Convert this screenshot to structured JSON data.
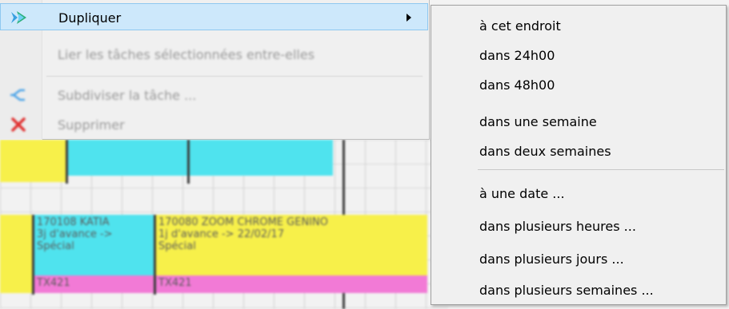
{
  "context_menu": {
    "items": [
      {
        "label": "Dupliquer",
        "icon": "duplicate-icon",
        "state": "highlighted",
        "has_submenu": true
      },
      {
        "label": "Lier les tâches sélectionnées entre-elles",
        "icon": "",
        "state": "disabled"
      },
      {
        "label": "Subdiviser la tâche ...",
        "icon": "split-icon",
        "state": "disabled"
      },
      {
        "label": "Supprimer",
        "icon": "delete-icon",
        "state": "disabled"
      }
    ]
  },
  "submenu": {
    "groups": [
      [
        "à cet endroit",
        "dans 24h00",
        "dans 48h00",
        "dans une semaine",
        "dans deux semaines"
      ],
      [
        "à une date ...",
        "dans plusieurs heures ...",
        "dans plusieurs jours ...",
        "dans plusieurs semaines ..."
      ]
    ]
  },
  "background_schedule": {
    "blocks": [
      {
        "text": "170108 KATIA",
        "line2": "3j d'avance ->",
        "line3": "Spécial",
        "code": "TX421"
      },
      {
        "text": "170080 ZOOM CHROME GENINO",
        "line2": "1j d'avance -> 22/02/17",
        "line3": "Spécial",
        "code": "TX421"
      }
    ]
  },
  "colors": {
    "menu_bg": "#f0f0f0",
    "highlight_bg": "#cde8fb",
    "highlight_border": "#8ec8f0",
    "block_yellow": "#f7f04a",
    "block_cyan": "#4fe3ee",
    "block_pink": "#f27ad6",
    "icon_blue": "#3aa0e0",
    "icon_red": "#e03030"
  }
}
